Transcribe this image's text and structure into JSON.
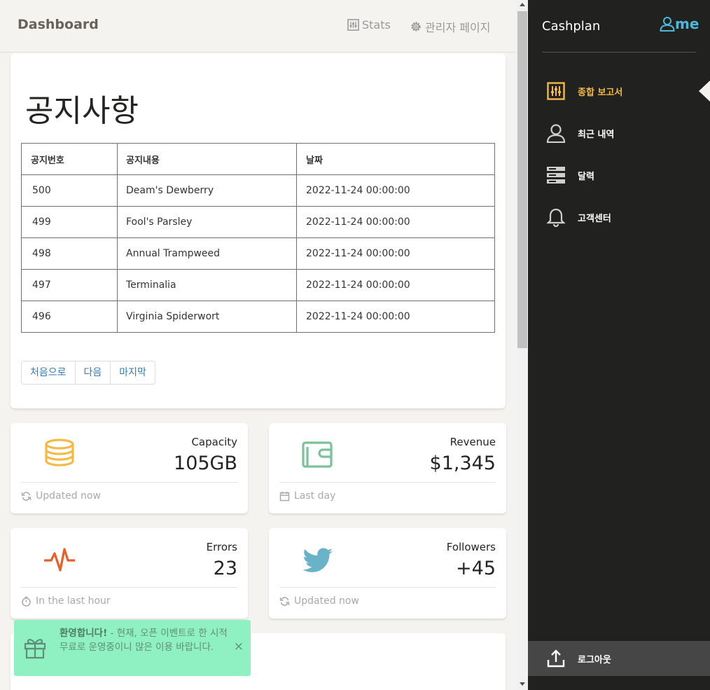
{
  "header": {
    "brand": "Dashboard",
    "nav": [
      {
        "label": "Stats",
        "icon": "sliders-icon"
      },
      {
        "label": "관리자 페이지",
        "icon": "gear-icon"
      }
    ]
  },
  "notice": {
    "title": "공지사항",
    "columns": [
      "공지번호",
      "공지내용",
      "날짜"
    ],
    "rows": [
      {
        "id": "500",
        "content": "Deam's Dewberry",
        "date": "2022-11-24 00:00:00"
      },
      {
        "id": "499",
        "content": "Fool's Parsley",
        "date": "2022-11-24 00:00:00"
      },
      {
        "id": "498",
        "content": "Annual Trampweed",
        "date": "2022-11-24 00:00:00"
      },
      {
        "id": "497",
        "content": "Terminalia",
        "date": "2022-11-24 00:00:00"
      },
      {
        "id": "496",
        "content": "Virginia Spiderwort",
        "date": "2022-11-24 00:00:00"
      }
    ],
    "pager": [
      "처음으로",
      "다음",
      "마지막"
    ]
  },
  "stats": [
    {
      "label": "Capacity",
      "value": "105GB",
      "footer": "Updated now",
      "icon": "database-icon",
      "footer_icon": "refresh-icon",
      "color": "#f3bb45"
    },
    {
      "label": "Revenue",
      "value": "$1,345",
      "footer": "Last day",
      "icon": "wallet-icon",
      "footer_icon": "calendar-icon",
      "color": "#7ac29a"
    },
    {
      "label": "Errors",
      "value": "23",
      "footer": "In the last hour",
      "icon": "pulse-icon",
      "footer_icon": "timer-icon",
      "color": "#eb5e28"
    },
    {
      "label": "Followers",
      "value": "+45",
      "footer": "Updated now",
      "icon": "twitter-icon",
      "footer_icon": "refresh-icon",
      "color": "#68b3c8"
    }
  ],
  "toast": {
    "title": "환영합니다!",
    "message": " - 현재, 오픈 이벤트로 한 시적 무료로 운영중이니 많은 이용 바랍니다.",
    "close": "×",
    "bg_color": "#8ff0c1"
  },
  "sidebar": {
    "brand": "Cashplan",
    "user": "me",
    "items": [
      {
        "label": "종합 보고서",
        "icon": "panel-filter-icon",
        "active": true
      },
      {
        "label": "최근 내역",
        "icon": "user-icon",
        "active": false
      },
      {
        "label": "달력",
        "icon": "server-icon",
        "active": false
      },
      {
        "label": "고객센터",
        "icon": "bell-icon",
        "active": false
      }
    ],
    "logout": "로그아웃",
    "active_color": "#f3bb45"
  }
}
